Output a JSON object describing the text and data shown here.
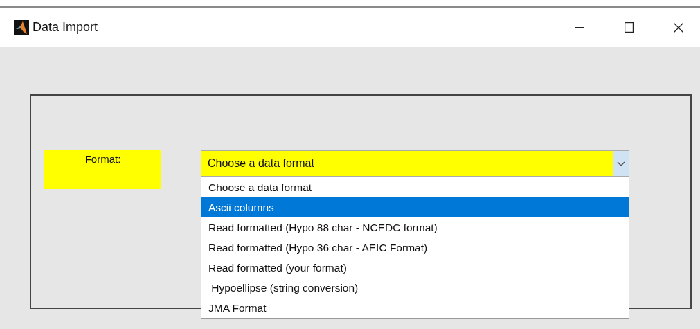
{
  "window": {
    "title": "Data Import"
  },
  "format_label": "Format:",
  "format_dropdown": {
    "value": "Choose a data format",
    "expanded": true,
    "options": [
      {
        "label": "Choose a data format",
        "highlighted": false
      },
      {
        "label": "Ascii columns",
        "highlighted": true
      },
      {
        "label": "Read formatted (Hypo 88 char - NCEDC format)",
        "highlighted": false
      },
      {
        "label": "Read formatted (Hypo 36 char - AEIC Format)",
        "highlighted": false
      },
      {
        "label": "Read formatted (your format)",
        "highlighted": false
      },
      {
        "label": " Hypoellipse (string conversion)",
        "highlighted": false
      },
      {
        "label": "JMA Format",
        "highlighted": false
      }
    ]
  }
}
